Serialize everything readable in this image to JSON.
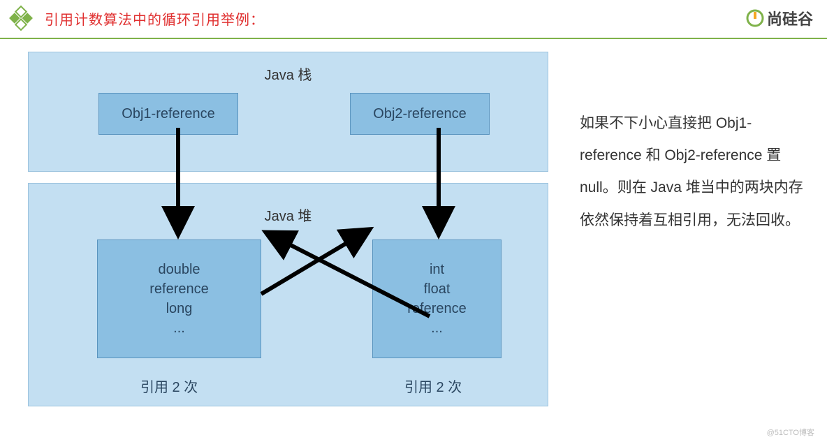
{
  "header": {
    "title": "引用计数算法中的循环引用举例：",
    "brand": "尚硅谷"
  },
  "diagram": {
    "stack_label": "Java 栈",
    "heap_label": "Java 堆",
    "obj1_label": "Obj1-reference",
    "obj2_label": "Obj2-reference",
    "heap_left_lines": [
      "double",
      "reference",
      "long",
      "..."
    ],
    "heap_right_lines": [
      "int",
      "float",
      "reference",
      "..."
    ],
    "count_left": "引用 2 次",
    "count_right": "引用 2 次"
  },
  "explanation": "如果不下小心直接把 Obj1-reference 和 Obj2-reference 置 null。则在 Java 堆当中的两块内存依然保持着互相引用，无法回收。",
  "watermark": "@51CTO博客"
}
